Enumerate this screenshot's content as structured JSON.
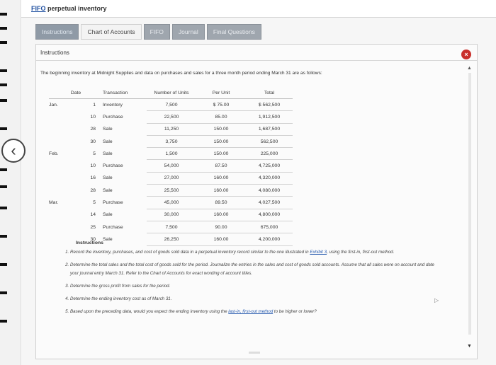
{
  "window": {
    "title_prefix": "FIFO",
    "title_rest": " perpetual inventory"
  },
  "tabs": [
    {
      "label": "Instructions"
    },
    {
      "label": "Chart of Accounts"
    },
    {
      "label": "FIFO"
    },
    {
      "label": "Journal"
    },
    {
      "label": "Final Questions"
    }
  ],
  "panel": {
    "header": "Instructions",
    "close": "×"
  },
  "intro": "The beginning inventory at Midnight Supplies and data on purchases and sales for a three month period ending March 31 are as follows:",
  "table": {
    "headers": {
      "date": "Date",
      "transaction": "Transaction",
      "units": "Number of Units",
      "cost": "Per Unit",
      "total": "Total"
    },
    "rows": [
      {
        "month": "Jan.",
        "day": "1",
        "trans": "Inventory",
        "units": "7,500",
        "cost": "$ 75.00",
        "total": "$ 562,500"
      },
      {
        "month": "",
        "day": "10",
        "trans": "Purchase",
        "units": "22,500",
        "cost": "85.00",
        "total": "1,912,500"
      },
      {
        "month": "",
        "day": "28",
        "trans": "Sale",
        "units": "11,250",
        "cost": "150.00",
        "total": "1,687,500"
      },
      {
        "month": "",
        "day": "30",
        "trans": "Sale",
        "units": "3,750",
        "cost": "150.00",
        "total": "562,500"
      },
      {
        "month": "Feb.",
        "day": "5",
        "trans": "Sale",
        "units": "1,500",
        "cost": "150.00",
        "total": "225,000"
      },
      {
        "month": "",
        "day": "10",
        "trans": "Purchase",
        "units": "54,000",
        "cost": "87.50",
        "total": "4,725,000"
      },
      {
        "month": "",
        "day": "16",
        "trans": "Sale",
        "units": "27,000",
        "cost": "160.00",
        "total": "4,320,000"
      },
      {
        "month": "",
        "day": "28",
        "trans": "Sale",
        "units": "25,500",
        "cost": "160.00",
        "total": "4,080,000"
      },
      {
        "month": "Mar.",
        "day": "5",
        "trans": "Purchase",
        "units": "45,000",
        "cost": "89.50",
        "total": "4,027,500"
      },
      {
        "month": "",
        "day": "14",
        "trans": "Sale",
        "units": "30,000",
        "cost": "160.00",
        "total": "4,800,000"
      },
      {
        "month": "",
        "day": "25",
        "trans": "Purchase",
        "units": "7,500",
        "cost": "90.00",
        "total": "675,000"
      },
      {
        "month": "",
        "day": "30",
        "trans": "Sale",
        "units": "26,250",
        "cost": "160.00",
        "total": "4,200,000"
      }
    ]
  },
  "instructions": {
    "title": "Instructions",
    "item1_a": "Record the inventory, purchases, and cost of goods sold data in a perpetual inventory record similar to the one illustrated in ",
    "item1_link": "Exhibit 3",
    "item1_b": ", using the first-in, first-out method.",
    "item2": "Determine the total sales and the total cost of goods sold for the period. Journalize the entries in the sales and cost of goods sold accounts. Assume that all sales were on account and date your journal entry March 31. Refer to the Chart of Accounts for exact wording of account titles.",
    "item3": "Determine the gross profit from sales for the period.",
    "item4": "Determine the ending inventory cost as of March 31.",
    "item5_a": "Based upon the preceding data, would you expect the ending inventory using the ",
    "item5_link": "last-in, first-out method",
    "item5_b": " to be higher or lower?"
  },
  "nav": {
    "prev": "‹"
  }
}
